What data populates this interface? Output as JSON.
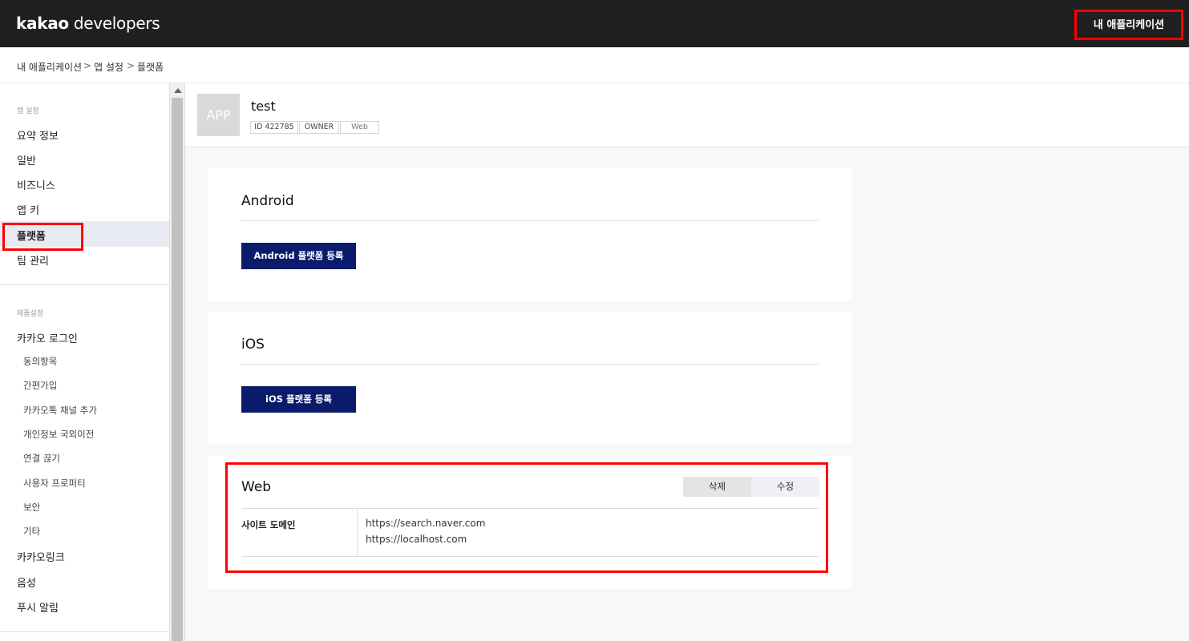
{
  "topbar": {
    "brand_bold": "kakao",
    "brand_light": "developers",
    "my_apps_label": "내 애플리케이션"
  },
  "breadcrumb": {
    "items": [
      "내 애플리케이션",
      "앱 설정",
      "플랫폼"
    ],
    "separator": ">"
  },
  "sidebar": {
    "app_section_title": "앱 설정",
    "app_items": [
      "요약 정보",
      "일반",
      "비즈니스",
      "앱 키",
      "플랫폼",
      "팀 관리"
    ],
    "active_item": "플랫폼",
    "product_section_title": "제품설정",
    "kakao_login": "카카오 로그인",
    "kakao_login_sub": [
      "동의항목",
      "간편가입",
      "카카오톡 채널 추가",
      "개인정보 국외이전",
      "연결 끊기",
      "사용자 프로퍼티",
      "보안",
      "기타"
    ],
    "more_items": [
      "카카오링크",
      "음성",
      "푸시 알림"
    ]
  },
  "app": {
    "icon_text": "APP",
    "name": "test",
    "badges": [
      "ID 422785",
      "OWNER",
      "Web"
    ]
  },
  "android": {
    "title": "Android",
    "register_label": "Android 플랫폼 등록"
  },
  "ios": {
    "title": "iOS",
    "register_label": "iOS 플랫폼 등록"
  },
  "web": {
    "title": "Web",
    "delete_label": "삭제",
    "edit_label": "수정",
    "site_domain_label": "사이트 도메인",
    "domains": [
      "https://search.naver.com",
      "https://localhost.com"
    ]
  },
  "colors": {
    "topbar": "#1f1f1f",
    "primary_button": "#0b1b6b",
    "highlight": "#ff0000",
    "active_bg": "#e9ebf3"
  }
}
